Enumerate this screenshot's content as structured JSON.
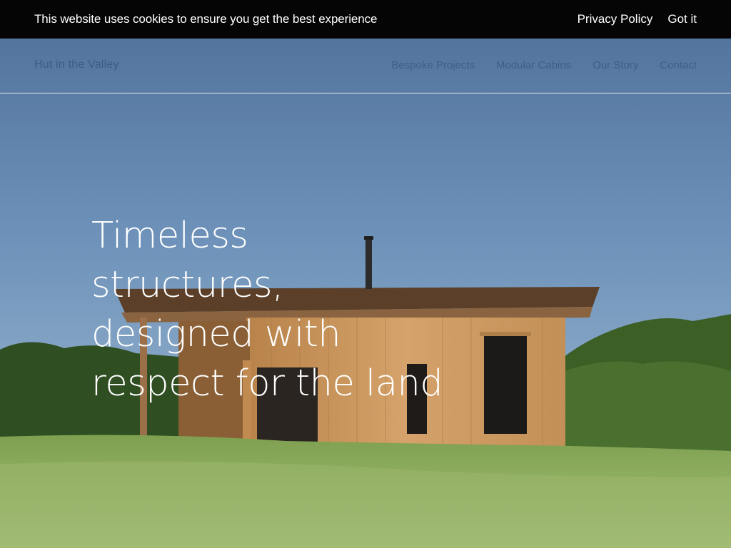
{
  "cookie_banner": {
    "message": "This website uses cookies to ensure you get the best experience",
    "privacy_link": "Privacy Policy",
    "accept_label": "Got it"
  },
  "header": {
    "logo": "Hut in the Valley",
    "nav": [
      "Bespoke Projects",
      "Modular Cabins",
      "Our Story",
      "Contact"
    ]
  },
  "hero": {
    "headline_lines": [
      "Timeless",
      "structures,",
      "designed with",
      "respect for the land"
    ]
  },
  "colors": {
    "banner_bg": "#050505",
    "sky_top": "#4f739c",
    "sky_bottom": "#9fbad3",
    "grass": "#8fae60",
    "wood": "#c7945a"
  }
}
